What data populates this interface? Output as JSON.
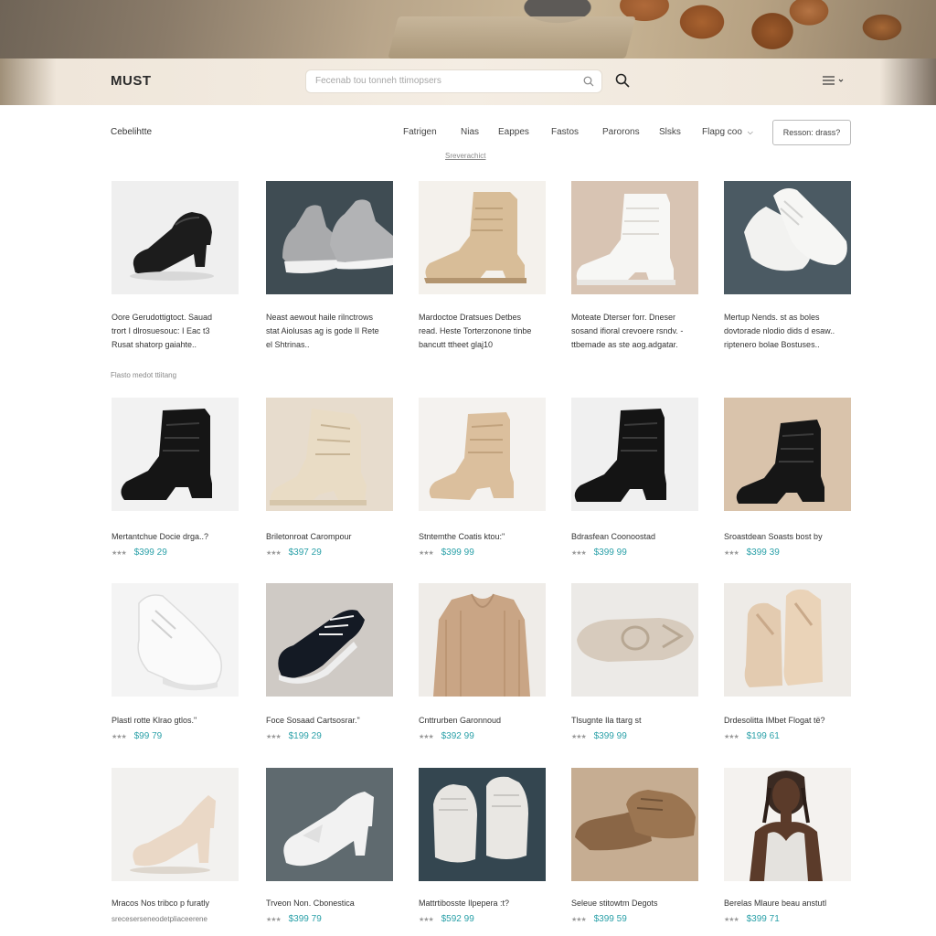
{
  "header": {
    "logo": "MUST",
    "search_placeholder": "Fecenab tou tonneh ttimopsers",
    "search_icon": "search-icon",
    "menu_icon": "menu-icon"
  },
  "nav": {
    "category": "Cebelihtte",
    "items": [
      "Fatrigen",
      "Nias",
      "Eappes",
      "Fastos",
      "Parorons",
      "Slsks",
      "Flapg coo"
    ],
    "sub_link": "Sreverachict",
    "button": "Resson: drass?"
  },
  "section_note": "Flasto medot ttiitang",
  "colors": {
    "accent": "#2aa0a8"
  },
  "row1": [
    {
      "lines": [
        "Oore Gerudottigtoct. Sauad",
        "trort I dlrosuesouc: I Eac t3",
        "Rusat shatorp gaiahte.."
      ]
    },
    {
      "lines": [
        "Neast aewout haile rilnctrows",
        "stat Aiolusas ag is gode II Rete",
        "el Shtrinas.."
      ]
    },
    {
      "lines": [
        "Mardoctoe Dratsues Detbes",
        "read. Heste Torterzonone tinbe",
        "bancutt ttheet glaj10"
      ]
    },
    {
      "lines": [
        "Moteate Dterser forr. Dneser",
        "sosand ifioral crevoere rsndv. -",
        "ttbemade as ste aog.adgatar."
      ]
    },
    {
      "lines": [
        "Mertup Nends. st as boles",
        "dovtorade nlodio dids d esaw..",
        "riptenero bolae Bostuses.."
      ]
    }
  ],
  "row2": [
    {
      "name": "Mertantchue Docie drga..?",
      "price": "$399 29",
      "stars": "★★★"
    },
    {
      "name": "Briletonroat Carompour",
      "price": "$397 29",
      "stars": "★★★"
    },
    {
      "name": "Stntemthe Coatis ktou:\"",
      "price": "$399 99",
      "stars": "★★★"
    },
    {
      "name": "Bdrasfean Coonoostad",
      "price": "$399 99",
      "stars": "★★★"
    },
    {
      "name": "Sroastdean Soasts bost by",
      "price": "$399 39",
      "stars": "★★★"
    }
  ],
  "row3": [
    {
      "name": "Plastl rotte Klrao gtlos.\"",
      "price": "$99 79",
      "stars": "★★★"
    },
    {
      "name": "Foce Sosaad Cartsosrar.\"",
      "price": "$199 29",
      "stars": "★★★"
    },
    {
      "name": "Cnttrurben Garonnoud",
      "price": "$392 99",
      "stars": "★★★"
    },
    {
      "name": "Tlsugnte Ila ttarg st",
      "price": "$399 99",
      "stars": "★★★"
    },
    {
      "name": "Drdesolitta IMbet Flogat të?",
      "price": "$199 61",
      "stars": "★★★"
    }
  ],
  "row4": [
    {
      "name": "Mracos Nos tribco p furatly",
      "sub": "sreceserseneodetpliaceerene"
    },
    {
      "name": "Trveon Non. Cbonestica",
      "price": "$399 79",
      "stars": "★★★"
    },
    {
      "name": "Mattrtibosste Ilpepera :t?",
      "price": "$592 99",
      "stars": "★★★"
    },
    {
      "name": "Seleue stitowtm Degots",
      "price": "$399 59",
      "stars": "★★★"
    },
    {
      "name": "Berelas Mlaure beau anstutl",
      "price": "$399 71",
      "stars": "★★★"
    }
  ]
}
